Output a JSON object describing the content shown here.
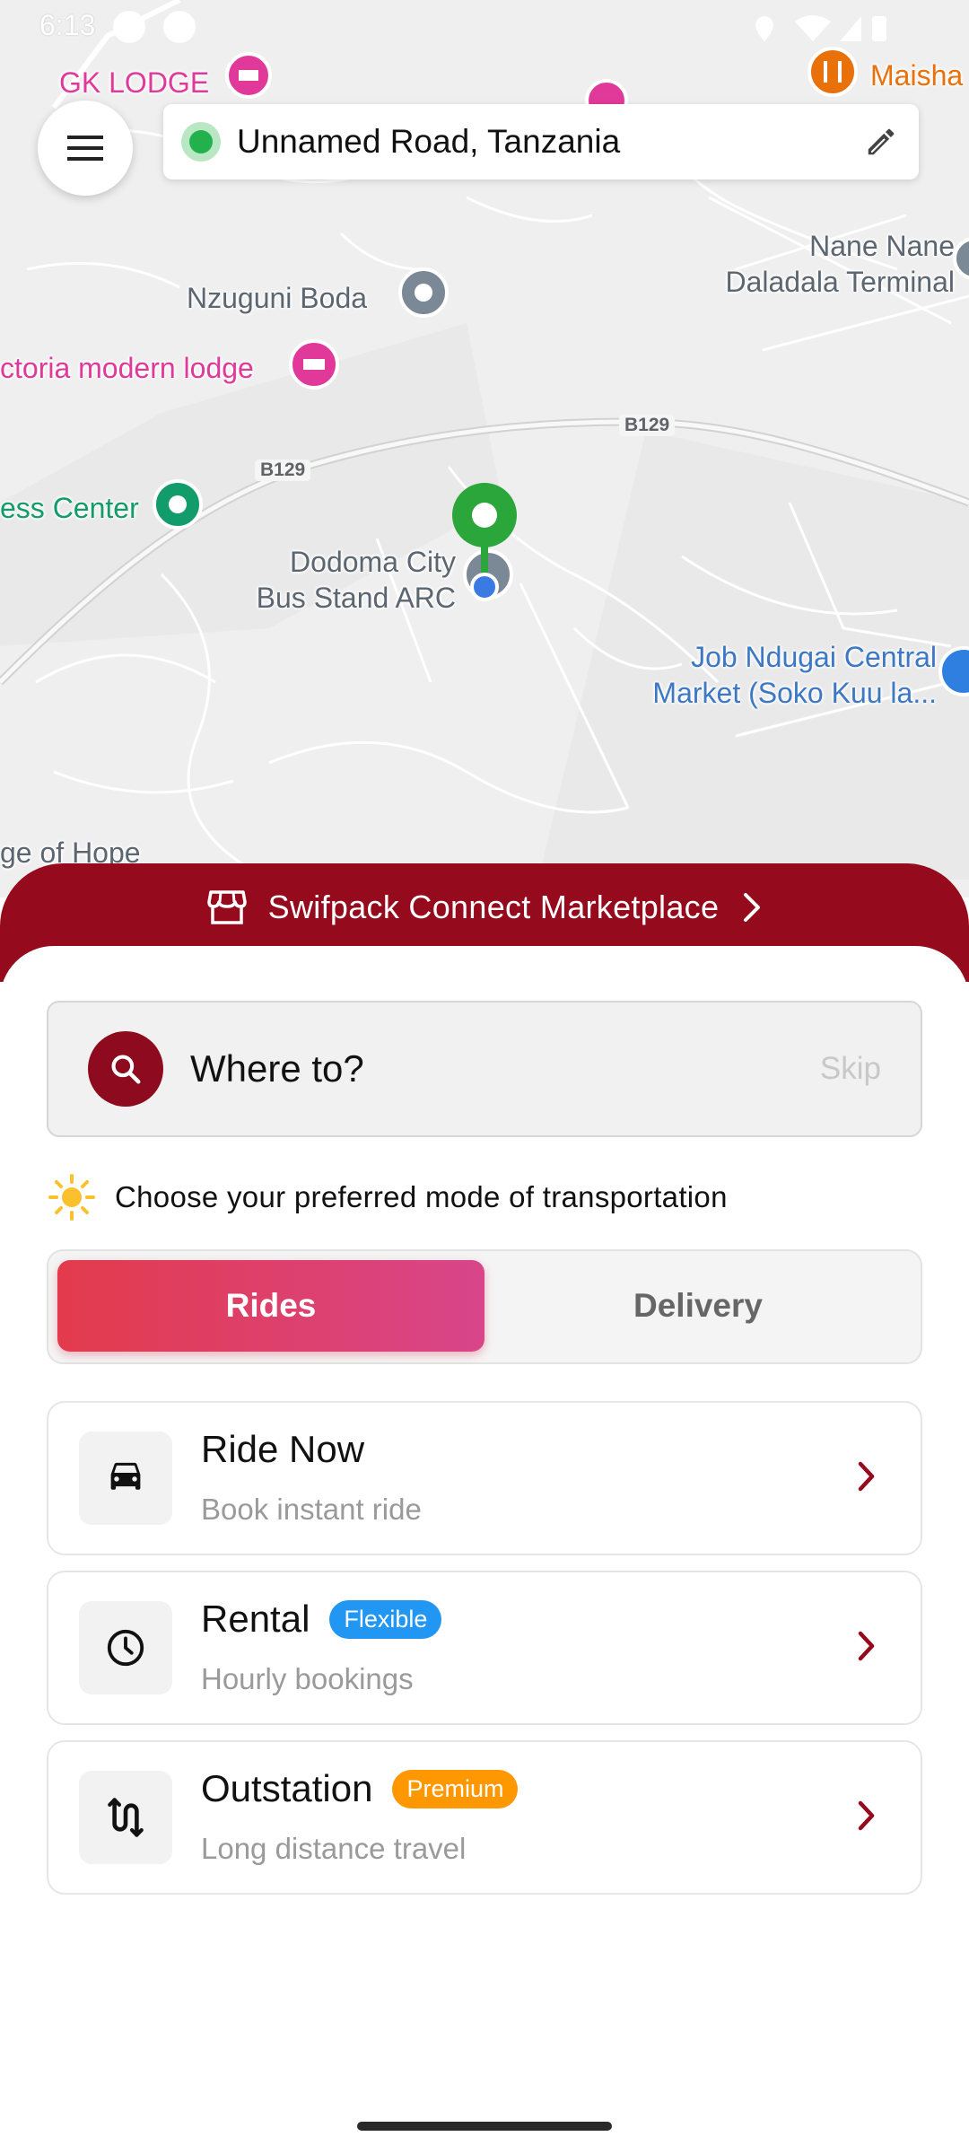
{
  "status_bar": {
    "time": "6:13"
  },
  "map": {
    "labels": {
      "gk_lodge": "GK LODGE",
      "maisha": "Maisha",
      "nzuguni_boda": "Nzuguni Boda",
      "nane_nane_line1": "Nane Nane",
      "nane_nane_line2": "Daladala Terminal",
      "victoria_lodge": "ctoria modern lodge",
      "business_center": "ess Center",
      "road_b129_a": "B129",
      "road_b129_b": "B129",
      "bus_stand_line1": "Dodoma City",
      "bus_stand_line2": "Bus Stand ARC",
      "market_line1": "Job Ndugai Central",
      "market_line2": "Market (Soko Kuu la...",
      "hope": "ge of Hope"
    },
    "colors": {
      "lodging": "#e0399a",
      "food": "#e8710a",
      "green_poi": "#139c6b",
      "transit": "#3c78c3",
      "pin": "#2aa63a"
    }
  },
  "top_bar": {
    "menu_icon": "hamburger-menu-icon",
    "address": "Unnamed Road, Tanzania",
    "edit_icon": "pencil-icon"
  },
  "banner": {
    "icon": "storefront-icon",
    "label": "Swifpack Connect Marketplace",
    "chevron": "chevron-right-icon",
    "color": "#950a1c"
  },
  "search": {
    "placeholder": "Where to?",
    "skip_label": "Skip",
    "icon": "search-icon"
  },
  "mode_prompt": {
    "icon": "sun-icon",
    "text": "Choose your preferred mode of transportation"
  },
  "tabs": [
    {
      "label": "Rides",
      "selected": true
    },
    {
      "label": "Delivery",
      "selected": false
    }
  ],
  "options": [
    {
      "title": "Ride Now",
      "subtitle": "Book instant ride",
      "icon": "car-icon",
      "badge": ""
    },
    {
      "title": "Rental",
      "subtitle": "Hourly bookings",
      "icon": "clock-icon",
      "badge": "Flexible",
      "badge_color": "#2196f3"
    },
    {
      "title": "Outstation",
      "subtitle": "Long distance travel",
      "icon": "route-icon",
      "badge": "Premium",
      "badge_color": "#ff9800"
    }
  ]
}
